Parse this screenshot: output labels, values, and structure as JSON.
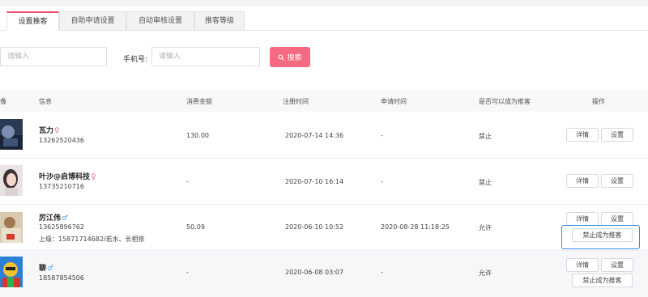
{
  "tabs": [
    {
      "label": "设置推客",
      "active": true
    },
    {
      "label": "自助申请设置",
      "active": false
    },
    {
      "label": "自动审核设置",
      "active": false
    },
    {
      "label": "推客等级",
      "active": false
    }
  ],
  "filters": {
    "first_placeholder": "请输入",
    "phone_label": "手机号:",
    "phone_placeholder": "请输入",
    "search_label": "搜索"
  },
  "table": {
    "headers": [
      "像",
      "信息",
      "消费金额",
      "注册时间",
      "申请时间",
      "是否可以成为推客",
      "操作"
    ],
    "rows": [
      {
        "name": "瓦力",
        "gender": "♀",
        "phone": "13262520436",
        "upline": "",
        "amount": "130.00",
        "reg_time": "2020-07-14 14:36",
        "apply_time": "-",
        "can_be": "禁止",
        "actions": [
          "详情",
          "设置"
        ]
      },
      {
        "name": "叶沙@启博科技",
        "gender": "♀",
        "phone": "13735210716",
        "upline": "",
        "amount": "-",
        "reg_time": "2020-07-10 16:14",
        "apply_time": "-",
        "can_be": "禁止",
        "actions": [
          "详情",
          "设置"
        ]
      },
      {
        "name": "厉江伟",
        "gender": "♂",
        "phone": "13625896762",
        "upline": "上级：15871714682/若水、长相依",
        "amount": "50.09",
        "reg_time": "2020-06-10 10:52",
        "apply_time": "2020-08-28 11:18:25",
        "can_be": "允许",
        "actions": [
          "详情",
          "设置",
          "禁止成为推客"
        ]
      },
      {
        "name": "聊",
        "gender": "♂",
        "phone": "18587854506",
        "upline": "",
        "amount": "-",
        "reg_time": "2020-06-08 03:07",
        "apply_time": "-",
        "can_be": "允许",
        "actions": [
          "详情",
          "设置",
          "禁止成为推客"
        ]
      }
    ]
  },
  "colors": {
    "accent": "#f0506e",
    "highlight": "#3a8be6",
    "female": "#f06aa0",
    "male": "#55a9f0"
  }
}
